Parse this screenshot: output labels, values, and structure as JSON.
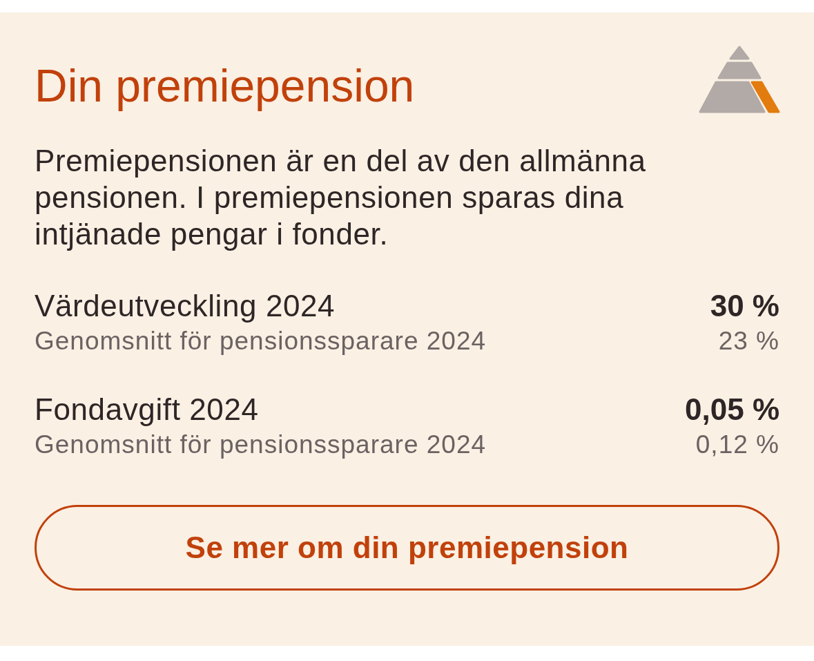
{
  "card": {
    "title": "Din premiepension",
    "description": "Premiepensionen är en del av den allmänna pensionen. I premiepensionen sparas dina intjänade pengar i fonder.",
    "metrics": [
      {
        "label": "Värdeutveckling 2024",
        "value": "30 %",
        "average_label": "Genomsnitt för pensionssparare 2024",
        "average_value": "23 %"
      },
      {
        "label": "Fondavgift 2024",
        "value": "0,05 %",
        "average_label": "Genomsnitt för pensionssparare 2024",
        "average_value": "0,12 %"
      }
    ],
    "button": "Se mer om din premiepension"
  }
}
